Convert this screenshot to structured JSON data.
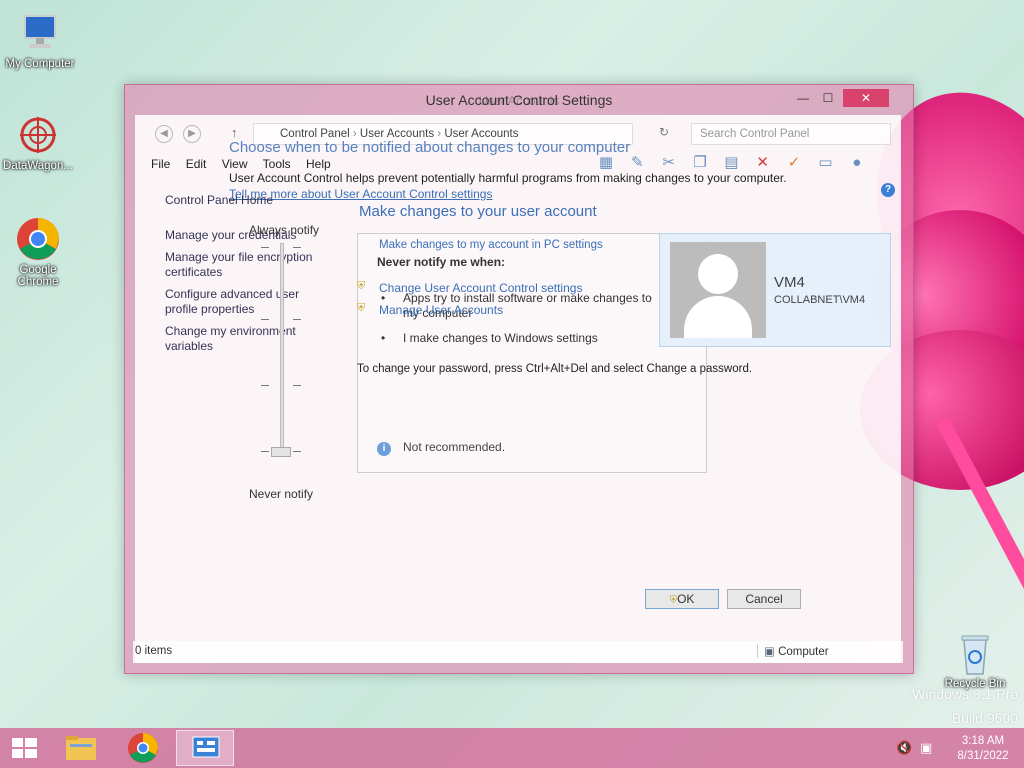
{
  "desktop": {
    "icons": [
      {
        "label": "My Computer"
      },
      {
        "label": "DataWagon..."
      },
      {
        "label": "Google Chrome"
      },
      {
        "label": "Recycle Bin"
      }
    ],
    "watermark": {
      "line1": "Windows 8.1 Pro",
      "line2": "Build 9600"
    }
  },
  "window": {
    "title": "User Account Control Settings",
    "title_ghost": "User Accounts",
    "controls": {
      "minimize": "—",
      "maximize": "☐",
      "close": "✕"
    },
    "address": {
      "crumbs": [
        "Control Panel",
        "User Accounts",
        "User Accounts"
      ],
      "search_placeholder": "Search Control Panel"
    },
    "menu": [
      "File",
      "Edit",
      "View",
      "Tools",
      "Help"
    ],
    "left_nav": {
      "home": "Control Panel Home",
      "items": [
        "Manage your credentials",
        "Manage your file encryption certificates",
        "Configure advanced user profile properties",
        "Change my environment variables"
      ]
    },
    "uac": {
      "heading": "Choose when to be notified about changes to your computer",
      "subtitle": "User Account Control helps prevent potentially harmful programs from making changes to your computer.",
      "learn_link": "Tell me more about User Account Control settings",
      "slider_top": "Always notify",
      "slider_bottom": "Never notify",
      "level_label": "Never notify me when:",
      "level": 0,
      "bullets": [
        "Apps try to install software or make changes to my computer",
        "I make changes to Windows settings"
      ],
      "info": "Not recommended.",
      "ok": "OK",
      "cancel": "Cancel"
    },
    "account": {
      "heading": "Make changes to your user account",
      "pc_settings_link": "Make changes to my account in PC settings",
      "uac_link": "Change User Account Control settings",
      "manage_link": "Manage User Accounts",
      "password_note": "To change your password, press Ctrl+Alt+Del and select Change a password.",
      "user_name": "VM4",
      "user_domain": "COLLABNET\\VM4"
    },
    "status": {
      "items": "0 items",
      "location": "Computer"
    }
  },
  "taskbar": {
    "time": "3:18 AM",
    "date": "8/31/2022"
  }
}
